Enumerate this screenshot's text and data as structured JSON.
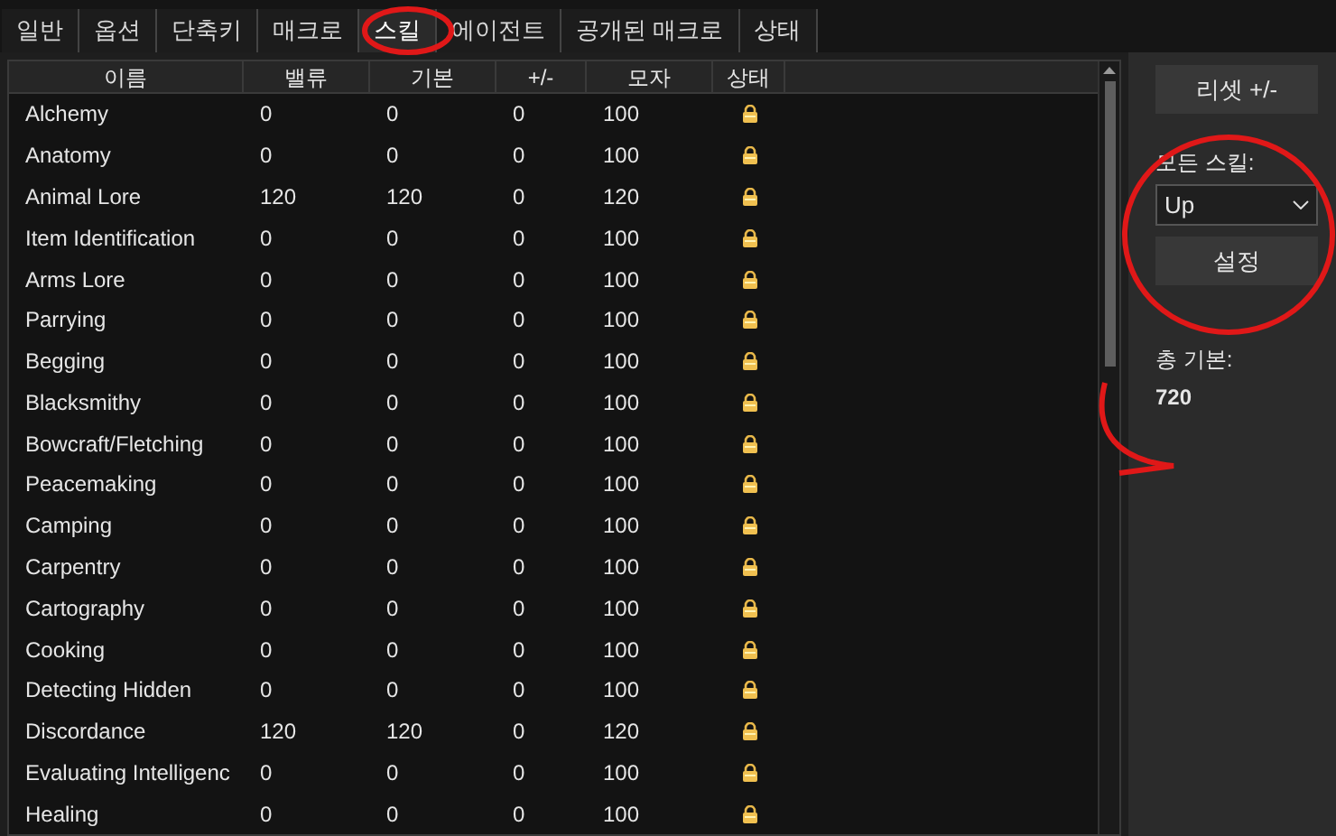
{
  "tabs": [
    {
      "label": "일반",
      "selected": false
    },
    {
      "label": "옵션",
      "selected": false
    },
    {
      "label": "단축키",
      "selected": false
    },
    {
      "label": "매크로",
      "selected": false
    },
    {
      "label": "스킬",
      "selected": true
    },
    {
      "label": "에이전트",
      "selected": false
    },
    {
      "label": "공개된 매크로",
      "selected": false
    },
    {
      "label": "상태",
      "selected": false
    }
  ],
  "table": {
    "columns": [
      "이름",
      "밸류",
      "기본",
      "+/-",
      "모자",
      "상태"
    ],
    "rows": [
      {
        "name": "Alchemy",
        "value": "0",
        "base": "0",
        "delta": "0",
        "cap": "100",
        "locked": true
      },
      {
        "name": "Anatomy",
        "value": "0",
        "base": "0",
        "delta": "0",
        "cap": "100",
        "locked": true
      },
      {
        "name": "Animal Lore",
        "value": "120",
        "base": "120",
        "delta": "0",
        "cap": "120",
        "locked": true
      },
      {
        "name": "Item Identification",
        "value": "0",
        "base": "0",
        "delta": "0",
        "cap": "100",
        "locked": true
      },
      {
        "name": "Arms Lore",
        "value": "0",
        "base": "0",
        "delta": "0",
        "cap": "100",
        "locked": true
      },
      {
        "name": "Parrying",
        "value": "0",
        "base": "0",
        "delta": "0",
        "cap": "100",
        "locked": true
      },
      {
        "name": "Begging",
        "value": "0",
        "base": "0",
        "delta": "0",
        "cap": "100",
        "locked": true
      },
      {
        "name": "Blacksmithy",
        "value": "0",
        "base": "0",
        "delta": "0",
        "cap": "100",
        "locked": true
      },
      {
        "name": "Bowcraft/Fletching",
        "value": "0",
        "base": "0",
        "delta": "0",
        "cap": "100",
        "locked": true
      },
      {
        "name": "Peacemaking",
        "value": "0",
        "base": "0",
        "delta": "0",
        "cap": "100",
        "locked": true
      },
      {
        "name": "Camping",
        "value": "0",
        "base": "0",
        "delta": "0",
        "cap": "100",
        "locked": true
      },
      {
        "name": "Carpentry",
        "value": "0",
        "base": "0",
        "delta": "0",
        "cap": "100",
        "locked": true
      },
      {
        "name": "Cartography",
        "value": "0",
        "base": "0",
        "delta": "0",
        "cap": "100",
        "locked": true
      },
      {
        "name": "Cooking",
        "value": "0",
        "base": "0",
        "delta": "0",
        "cap": "100",
        "locked": true
      },
      {
        "name": "Detecting Hidden",
        "value": "0",
        "base": "0",
        "delta": "0",
        "cap": "100",
        "locked": true
      },
      {
        "name": "Discordance",
        "value": "120",
        "base": "120",
        "delta": "0",
        "cap": "120",
        "locked": true
      },
      {
        "name": "Evaluating Intelligenc",
        "value": "0",
        "base": "0",
        "delta": "0",
        "cap": "100",
        "locked": true
      },
      {
        "name": "Healing",
        "value": "0",
        "base": "0",
        "delta": "0",
        "cap": "100",
        "locked": true
      }
    ]
  },
  "side": {
    "reset_button": "리셋 +/-",
    "all_skills_label": "모든 스킬:",
    "all_skills_value": "Up",
    "set_button": "설정",
    "total_label": "총 기본:",
    "total_value": "720"
  }
}
